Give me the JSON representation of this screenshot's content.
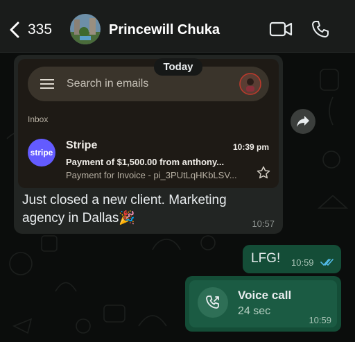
{
  "header": {
    "back_count": "335",
    "contact_name": "Princewill Chuka"
  },
  "date_divider": "Today",
  "incoming_message": {
    "screenshot": {
      "search_placeholder": "Search in emails",
      "inbox_label": "Inbox",
      "email": {
        "logo_text": "stripe",
        "sender": "Stripe",
        "time": "10:39 pm",
        "subject": "Payment of $1,500.00 from anthony...",
        "snippet": "Payment for Invoice - pi_3PUtLqHKbLSV..."
      }
    },
    "text_line1": "Just closed a new client. Marketing",
    "text_line2": "agency in Dallas🎉",
    "time": "10:57"
  },
  "outgoing_messages": [
    {
      "text": "LFG!",
      "time": "10:59"
    }
  ],
  "voice_call": {
    "title": "Voice call",
    "duration": "24 sec",
    "time": "10:59"
  },
  "colors": {
    "accent_green": "#144d37",
    "read_ticks": "#53bdeb",
    "stripe_brand": "#635bff"
  }
}
